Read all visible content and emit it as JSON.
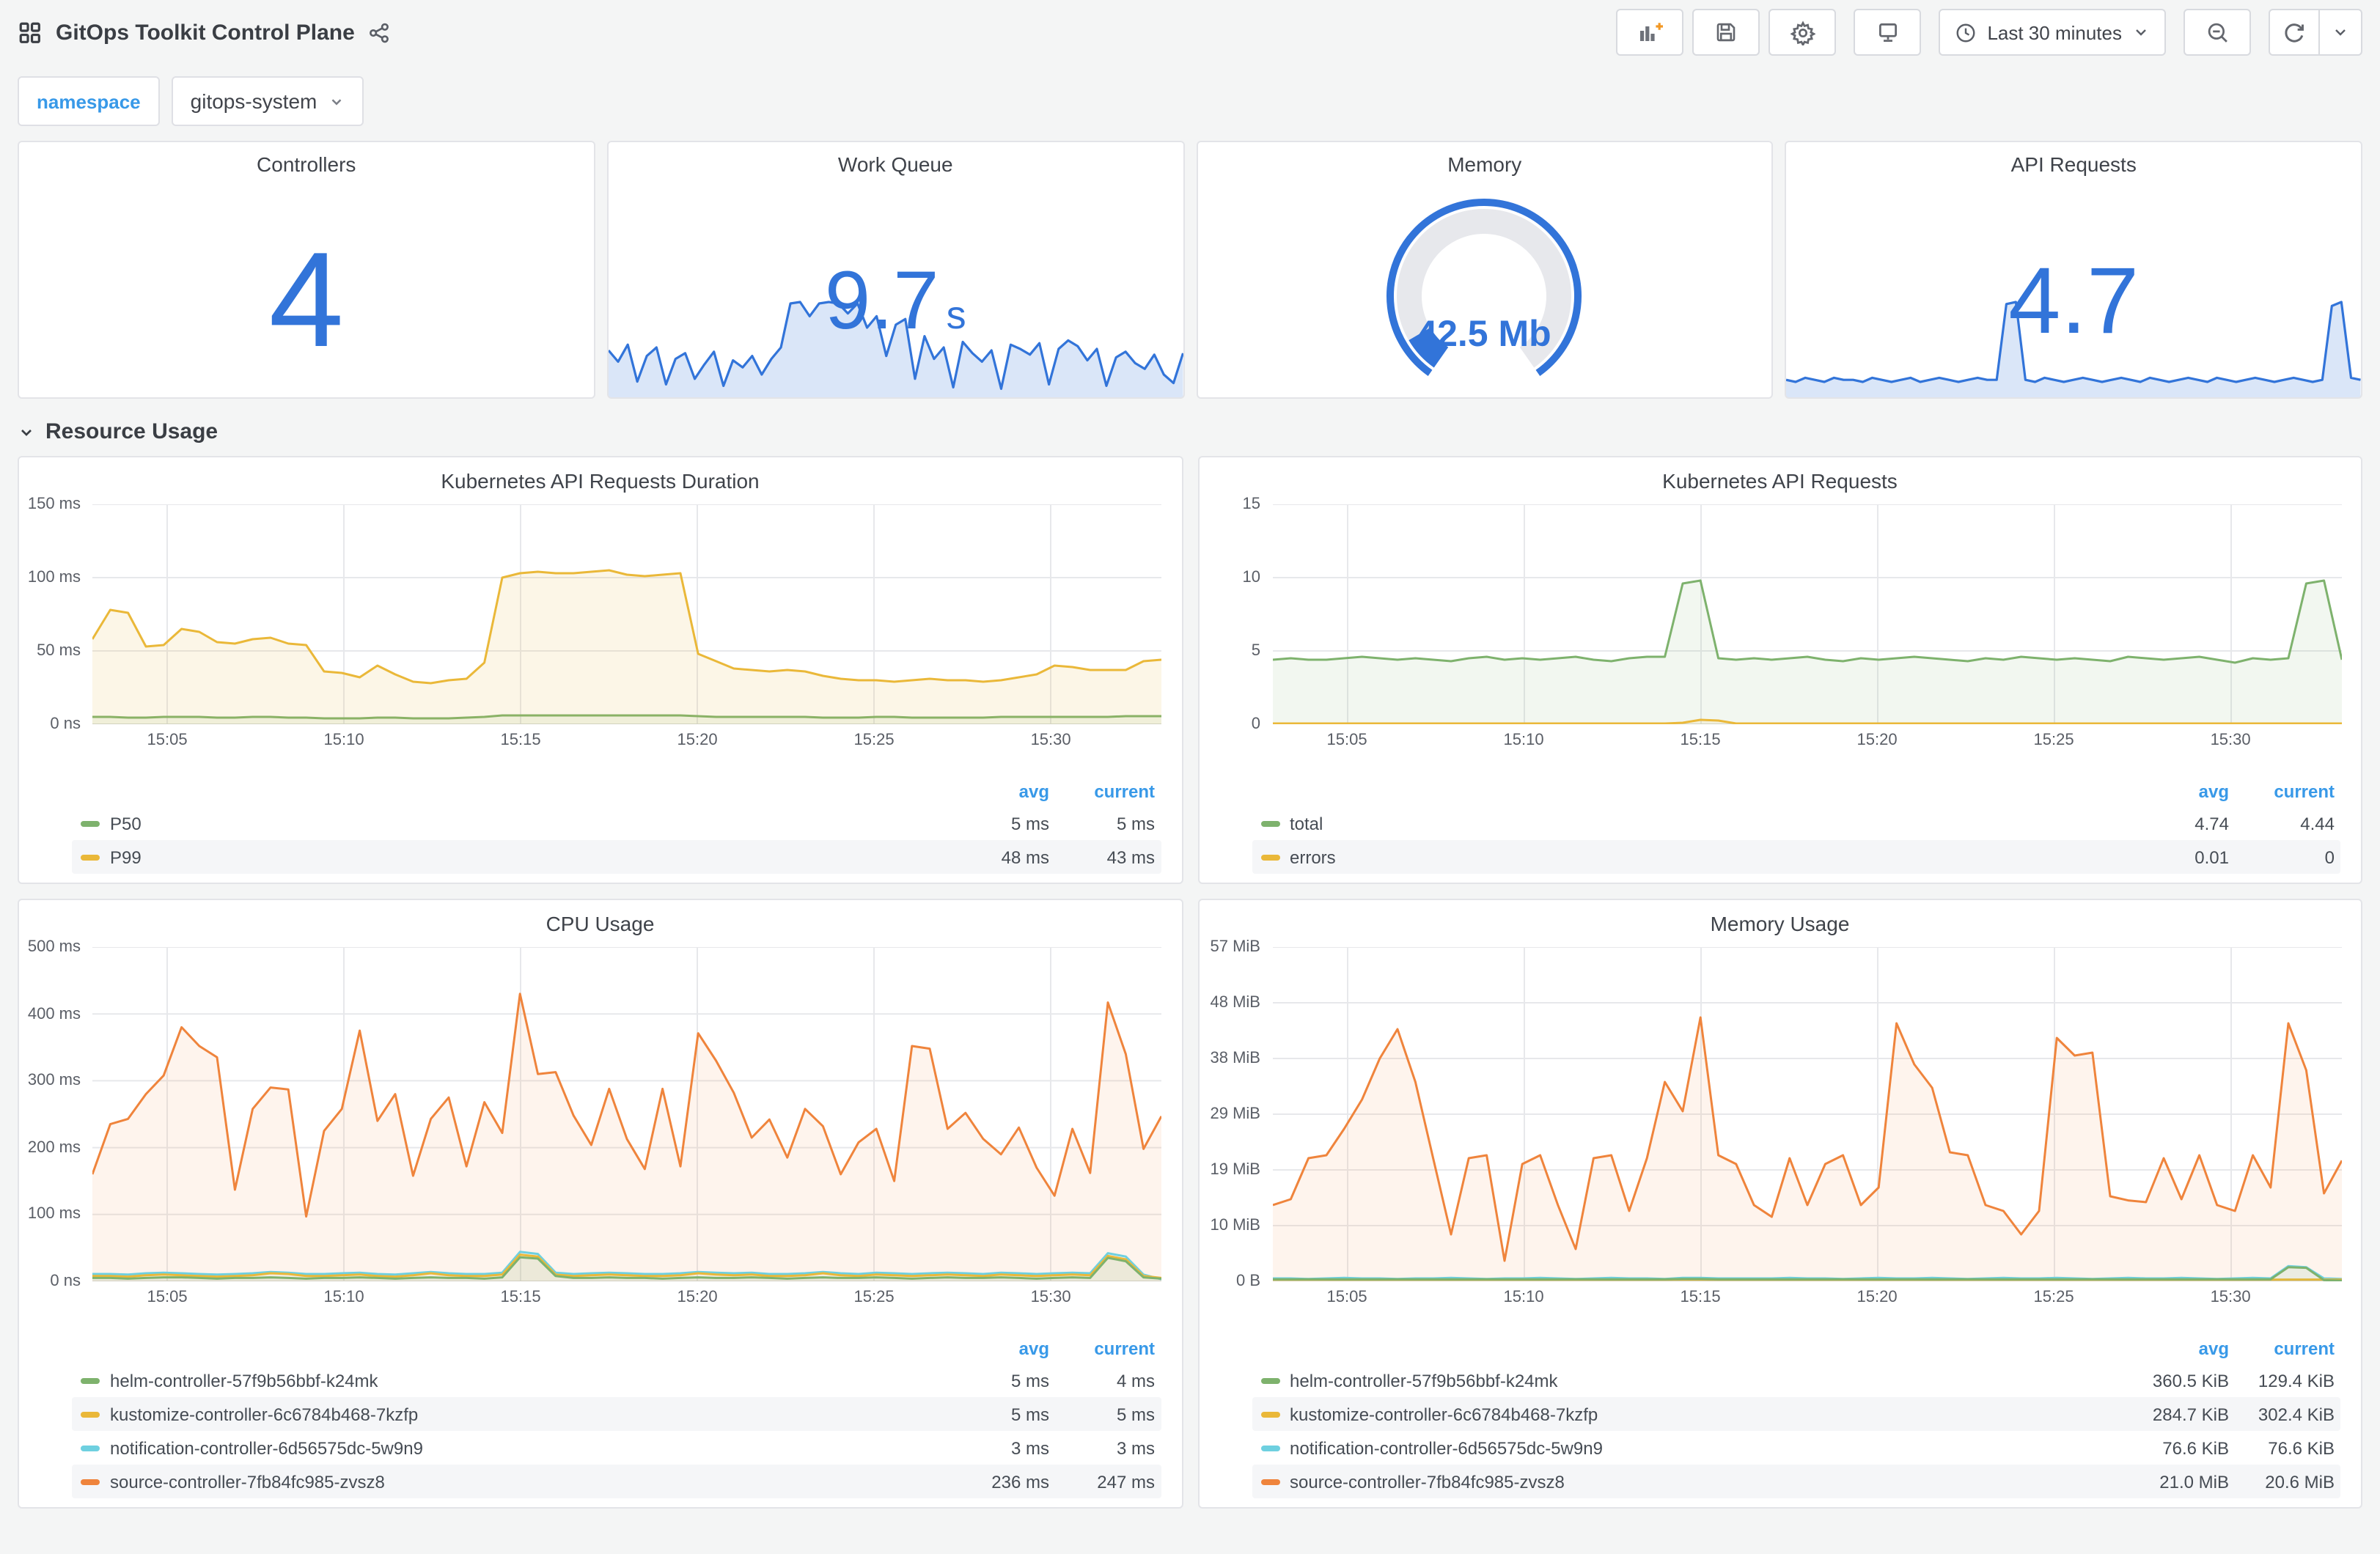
{
  "header": {
    "title": "GitOps Toolkit Control Plane",
    "time_range_label": "Last 30 minutes"
  },
  "variables": {
    "namespace_label": "namespace",
    "namespace_value": "gitops-system"
  },
  "row_section": {
    "title": "Resource Usage"
  },
  "colors": {
    "accent_blue": "#3274D9",
    "link_blue": "#3899E8",
    "green": "#7EB26D",
    "yellow": "#EAB839",
    "light_blue": "#6ED0E0",
    "orange": "#EF843C"
  },
  "stats": {
    "controllers": {
      "title": "Controllers",
      "value": "4"
    },
    "work_queue": {
      "title": "Work Queue",
      "value": "9.7",
      "unit": "s",
      "sparkline": [
        3.2,
        2.4,
        3.6,
        1.0,
        2.8,
        3.4,
        0.8,
        2.6,
        3.0,
        1.2,
        2.2,
        3.1,
        0.7,
        2.5,
        2.0,
        2.8,
        1.5,
        2.6,
        3.4,
        6.5,
        6.6,
        5.6,
        6.5,
        6.6,
        6.5,
        5.8,
        6.5,
        4.8,
        5.6,
        2.8,
        5.0,
        5.4,
        1.2,
        4.2,
        2.6,
        3.4,
        0.6,
        3.8,
        3.0,
        2.4,
        3.2,
        0.5,
        3.6,
        3.3,
        2.9,
        3.7,
        0.8,
        3.3,
        3.9,
        3.5,
        2.5,
        3.3,
        0.7,
        2.7,
        3.1,
        2.3,
        1.9,
        2.9,
        1.5,
        0.9,
        3.0
      ]
    },
    "memory": {
      "title": "Memory",
      "value": "42.5 Mb"
    },
    "api_requests": {
      "title": "API Requests",
      "value": "4.7",
      "sparkline": [
        0.8,
        0.7,
        0.9,
        0.8,
        0.7,
        0.9,
        0.8,
        0.8,
        0.7,
        0.9,
        0.8,
        0.7,
        0.8,
        0.9,
        0.7,
        0.8,
        0.9,
        0.8,
        0.7,
        0.8,
        0.9,
        0.8,
        0.8,
        4.6,
        4.7,
        0.8,
        0.7,
        0.9,
        0.8,
        0.7,
        0.8,
        0.9,
        0.8,
        0.7,
        0.8,
        0.9,
        0.8,
        0.7,
        0.9,
        0.8,
        0.7,
        0.8,
        0.9,
        0.8,
        0.7,
        0.9,
        0.8,
        0.7,
        0.8,
        0.9,
        0.8,
        0.7,
        0.8,
        0.9,
        0.8,
        0.7,
        0.8,
        4.5,
        4.7,
        0.9,
        0.8
      ]
    }
  },
  "chart_data": [
    {
      "type": "area",
      "title": "Kubernetes API Requests Duration",
      "x": [
        "15:05",
        "15:10",
        "15:15",
        "15:20",
        "15:25",
        "15:30"
      ],
      "y_ticks": [
        "0 ns",
        "50 ms",
        "100 ms",
        "150 ms"
      ],
      "ylim": [
        0,
        150
      ],
      "legend_columns": [
        "avg",
        "current"
      ],
      "series": [
        {
          "name": "P50",
          "color": "#7EB26D",
          "fill": 0.1,
          "avg": "5 ms",
          "current": "5 ms",
          "values": [
            5,
            5,
            4.5,
            4.5,
            5,
            5,
            5,
            4.5,
            4.5,
            5,
            5,
            4.5,
            4.5,
            4,
            4,
            4,
            4.5,
            4.5,
            4,
            4,
            4,
            4.5,
            5,
            6,
            6,
            6,
            6,
            6,
            6,
            6,
            6,
            6,
            6,
            6,
            5.5,
            5,
            5,
            5,
            5,
            5,
            5,
            4.5,
            4.5,
            4.5,
            5,
            5,
            4.5,
            4.5,
            4.5,
            4.5,
            4.5,
            5,
            5,
            5,
            5,
            5,
            5,
            5,
            5.5,
            5.5,
            5.5
          ]
        },
        {
          "name": "P99",
          "color": "#EAB839",
          "fill": 0.12,
          "avg": "48 ms",
          "current": "43 ms",
          "values": [
            58,
            78,
            76,
            53,
            54,
            65,
            63,
            56,
            55,
            58,
            59,
            55,
            54,
            36,
            35,
            32,
            40,
            34,
            29,
            28,
            30,
            31,
            42,
            100,
            103,
            104,
            103,
            103,
            104,
            105,
            102,
            101,
            102,
            103,
            48,
            43,
            38,
            37,
            36,
            37,
            36,
            33,
            31,
            30,
            30,
            29,
            30,
            31,
            30,
            30,
            29,
            30,
            32,
            34,
            40,
            39,
            37,
            37,
            37,
            43,
            44
          ]
        }
      ]
    },
    {
      "type": "area",
      "title": "Kubernetes API Requests",
      "x": [
        "15:05",
        "15:10",
        "15:15",
        "15:20",
        "15:25",
        "15:30"
      ],
      "y_ticks": [
        "0",
        "5",
        "10",
        "15"
      ],
      "ylim": [
        0,
        15
      ],
      "legend_columns": [
        "avg",
        "current"
      ],
      "series": [
        {
          "name": "total",
          "color": "#7EB26D",
          "fill": 0.1,
          "avg": "4.74",
          "current": "4.44",
          "values": [
            4.4,
            4.5,
            4.4,
            4.4,
            4.5,
            4.6,
            4.5,
            4.4,
            4.5,
            4.4,
            4.3,
            4.5,
            4.6,
            4.4,
            4.5,
            4.4,
            4.5,
            4.6,
            4.4,
            4.3,
            4.5,
            4.6,
            4.6,
            9.6,
            9.8,
            4.5,
            4.4,
            4.5,
            4.4,
            4.5,
            4.6,
            4.4,
            4.3,
            4.5,
            4.4,
            4.5,
            4.6,
            4.5,
            4.4,
            4.3,
            4.5,
            4.4,
            4.6,
            4.5,
            4.4,
            4.5,
            4.4,
            4.3,
            4.6,
            4.5,
            4.4,
            4.5,
            4.6,
            4.4,
            4.2,
            4.5,
            4.4,
            4.5,
            9.6,
            9.8,
            4.4
          ]
        },
        {
          "name": "errors",
          "color": "#EAB839",
          "fill": 0.1,
          "avg": "0.01",
          "current": "0",
          "values": [
            0.05,
            0.05,
            0.05,
            0.05,
            0.05,
            0.05,
            0.05,
            0.05,
            0.05,
            0.05,
            0.05,
            0.05,
            0.05,
            0.05,
            0.05,
            0.05,
            0.05,
            0.05,
            0.05,
            0.05,
            0.05,
            0.05,
            0.05,
            0.1,
            0.3,
            0.25,
            0.05,
            0.05,
            0.05,
            0.05,
            0.05,
            0.05,
            0.05,
            0.05,
            0.05,
            0.05,
            0.05,
            0.05,
            0.05,
            0.05,
            0.05,
            0.05,
            0.05,
            0.05,
            0.05,
            0.05,
            0.05,
            0.05,
            0.05,
            0.05,
            0.05,
            0.05,
            0.05,
            0.05,
            0.05,
            0.05,
            0.05,
            0.05,
            0.05,
            0.05,
            0.05
          ]
        }
      ]
    },
    {
      "type": "area",
      "title": "CPU Usage",
      "x": [
        "15:05",
        "15:10",
        "15:15",
        "15:20",
        "15:25",
        "15:30"
      ],
      "y_ticks": [
        "0 ns",
        "100 ms",
        "200 ms",
        "300 ms",
        "400 ms",
        "500 ms"
      ],
      "ylim": [
        0,
        500
      ],
      "legend_columns": [
        "avg",
        "current"
      ],
      "series": [
        {
          "name": "source-controller-7fb84fc985-zvsz8",
          "color": "#EF843C",
          "fill": 0.09,
          "avg": "236 ms",
          "current": "247 ms",
          "values": [
            160,
            235,
            243,
            280,
            308,
            380,
            352,
            335,
            137,
            258,
            290,
            287,
            97,
            225,
            258,
            375,
            240,
            280,
            158,
            243,
            275,
            172,
            268,
            222,
            430,
            310,
            313,
            248,
            204,
            288,
            213,
            168,
            288,
            172,
            371,
            330,
            282,
            215,
            242,
            185,
            258,
            232,
            160,
            208,
            228,
            150,
            352,
            348,
            228,
            252,
            213,
            190,
            230,
            170,
            128,
            228,
            162,
            417,
            340,
            198,
            247
          ]
        },
        {
          "name": "notification-controller-6d56575dc-5w9n9",
          "color": "#6ED0E0",
          "fill": 0.06,
          "avg": "3 ms",
          "current": "3 ms",
          "values": [
            11,
            11,
            10,
            12,
            13,
            12,
            11,
            10,
            11,
            12,
            14,
            13,
            11,
            11,
            12,
            13,
            11,
            10,
            12,
            14,
            12,
            11,
            11,
            13,
            44,
            41,
            13,
            11,
            12,
            13,
            12,
            11,
            11,
            12,
            14,
            13,
            12,
            13,
            11,
            11,
            12,
            14,
            12,
            11,
            13,
            12,
            11,
            12,
            13,
            12,
            11,
            13,
            12,
            11,
            12,
            13,
            12,
            42,
            37,
            10,
            3
          ]
        },
        {
          "name": "kustomize-controller-6c6784b468-7kzfp",
          "color": "#EAB839",
          "fill": 0.06,
          "avg": "5 ms",
          "current": "5 ms",
          "values": [
            8,
            8,
            7,
            9,
            10,
            9,
            8,
            7,
            8,
            9,
            12,
            11,
            8,
            8,
            9,
            10,
            8,
            7,
            9,
            12,
            9,
            8,
            8,
            10,
            40,
            37,
            10,
            8,
            9,
            10,
            9,
            8,
            8,
            9,
            12,
            10,
            9,
            10,
            8,
            8,
            9,
            12,
            9,
            8,
            10,
            9,
            8,
            9,
            10,
            9,
            8,
            10,
            9,
            8,
            9,
            10,
            9,
            38,
            33,
            8,
            5
          ]
        },
        {
          "name": "helm-controller-57f9b56bbf-k24mk",
          "color": "#7EB26D",
          "fill": 0.06,
          "avg": "5 ms",
          "current": "4 ms",
          "values": [
            5,
            5,
            4,
            5,
            6,
            6,
            5,
            4,
            5,
            5,
            6,
            5,
            4,
            5,
            5,
            6,
            5,
            4,
            5,
            6,
            5,
            5,
            4,
            6,
            36,
            34,
            8,
            5,
            5,
            6,
            5,
            5,
            4,
            5,
            6,
            5,
            5,
            6,
            5,
            4,
            5,
            6,
            5,
            5,
            6,
            5,
            4,
            5,
            6,
            5,
            5,
            6,
            5,
            4,
            5,
            6,
            5,
            35,
            30,
            6,
            4
          ]
        }
      ],
      "legend_order": [
        3,
        2,
        1,
        0
      ]
    },
    {
      "type": "area",
      "title": "Memory Usage",
      "x": [
        "15:05",
        "15:10",
        "15:15",
        "15:20",
        "15:25",
        "15:30"
      ],
      "y_ticks": [
        "0 B",
        "10 MiB",
        "19 MiB",
        "29 MiB",
        "38 MiB",
        "48 MiB",
        "57 MiB"
      ],
      "ylim": [
        0,
        57
      ],
      "legend_columns": [
        "avg",
        "current"
      ],
      "series": [
        {
          "name": "source-controller-7fb84fc985-zvsz8",
          "color": "#EF843C",
          "fill": 0.09,
          "avg": "21.0 MiB",
          "current": "20.6 MiB",
          "values": [
            13,
            14,
            21,
            21.5,
            26,
            31,
            38,
            43,
            34,
            21,
            8,
            21,
            21.5,
            3.5,
            20,
            21.5,
            13,
            5.5,
            21,
            21.5,
            12,
            21,
            34,
            29,
            45,
            21.5,
            20,
            13,
            11,
            21,
            13,
            20,
            21.5,
            13,
            16,
            44,
            37,
            33,
            22,
            21.5,
            13,
            12,
            8,
            12,
            41.5,
            38.5,
            39,
            14.5,
            13.8,
            13.5,
            21,
            14,
            21.5,
            13,
            12,
            21.5,
            16,
            44,
            36,
            15,
            20.6
          ]
        },
        {
          "name": "notification-controller-6d56575dc-5w9n9",
          "color": "#6ED0E0",
          "fill": 0.06,
          "avg": "76.6 KiB",
          "current": "76.6 KiB",
          "values": [
            0.5,
            0.5,
            0.4,
            0.5,
            0.6,
            0.5,
            0.5,
            0.4,
            0.5,
            0.5,
            0.6,
            0.5,
            0.4,
            0.5,
            0.5,
            0.6,
            0.5,
            0.4,
            0.5,
            0.6,
            0.5,
            0.5,
            0.4,
            0.6,
            0.6,
            0.5,
            0.5,
            0.5,
            0.5,
            0.6,
            0.5,
            0.5,
            0.4,
            0.5,
            0.6,
            0.5,
            0.5,
            0.6,
            0.5,
            0.4,
            0.5,
            0.6,
            0.5,
            0.5,
            0.6,
            0.5,
            0.4,
            0.5,
            0.6,
            0.5,
            0.5,
            0.6,
            0.5,
            0.4,
            0.5,
            0.6,
            0.5,
            2.6,
            2.4,
            0.5,
            0.4
          ]
        },
        {
          "name": "kustomize-controller-6c6784b468-7kzfp",
          "color": "#EAB839",
          "fill": 0.06,
          "avg": "284.7 KiB",
          "current": "302.4 KiB",
          "values": [
            0.28,
            0.28,
            0.28,
            0.28,
            0.28,
            0.28,
            0.28,
            0.28,
            0.28,
            0.28,
            0.28,
            0.28,
            0.28,
            0.28,
            0.28,
            0.28,
            0.28,
            0.28,
            0.28,
            0.28,
            0.28,
            0.28,
            0.28,
            0.3,
            0.3,
            0.28,
            0.28,
            0.28,
            0.28,
            0.28,
            0.28,
            0.28,
            0.28,
            0.28,
            0.28,
            0.28,
            0.28,
            0.28,
            0.28,
            0.28,
            0.28,
            0.28,
            0.28,
            0.28,
            0.28,
            0.28,
            0.28,
            0.28,
            0.28,
            0.28,
            0.28,
            0.28,
            0.28,
            0.28,
            0.28,
            0.28,
            0.28,
            0.3,
            0.3,
            0.3,
            0.3
          ]
        },
        {
          "name": "helm-controller-57f9b56bbf-k24mk",
          "color": "#7EB26D",
          "fill": 0.08,
          "avg": "360.5 KiB",
          "current": "129.4 KiB",
          "values": [
            0.35,
            0.35,
            0.35,
            0.35,
            0.35,
            0.35,
            0.35,
            0.35,
            0.35,
            0.35,
            0.35,
            0.35,
            0.35,
            0.35,
            0.35,
            0.35,
            0.35,
            0.35,
            0.35,
            0.35,
            0.35,
            0.35,
            0.35,
            0.4,
            0.4,
            0.35,
            0.35,
            0.35,
            0.35,
            0.35,
            0.35,
            0.35,
            0.35,
            0.35,
            0.35,
            0.35,
            0.35,
            0.35,
            0.35,
            0.35,
            0.35,
            0.35,
            0.35,
            0.35,
            0.35,
            0.35,
            0.35,
            0.35,
            0.35,
            0.35,
            0.35,
            0.35,
            0.35,
            0.35,
            0.35,
            0.35,
            0.35,
            2.4,
            2.3,
            0.2,
            0.13
          ]
        }
      ],
      "legend_order": [
        3,
        2,
        1,
        0
      ]
    }
  ]
}
